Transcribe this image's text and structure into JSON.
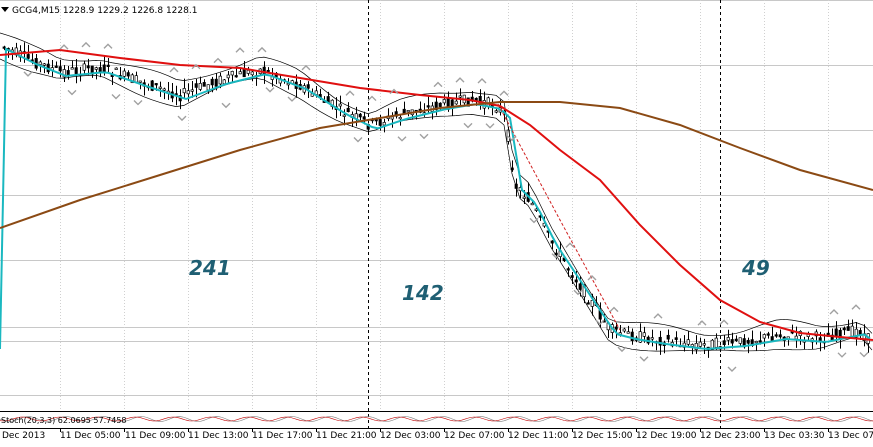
{
  "header": {
    "symbol_info": "GCG4,M15  1228.9 1229.2 1226.8 1228.1"
  },
  "annotations": {
    "left": "241",
    "middle": "142",
    "right": "49"
  },
  "oscillator": {
    "label": "Stoch(20,3,3) 62.0695 57.7458"
  },
  "time_axis": {
    "labels": [
      "Dec 2013",
      "11 Dec 05:00",
      "11 Dec 09:00",
      "11 Dec 13:00",
      "11 Dec 17:00",
      "11 Dec 21:00",
      "12 Dec 03:00",
      "12 Dec 07:00",
      "12 Dec 11:00",
      "12 Dec 15:00",
      "12 Dec 19:00",
      "12 Dec 23:00",
      "13 Dec 03:30",
      "13 Dec 07:"
    ]
  },
  "colors": {
    "background": "#ffffff",
    "grid": "#c8c8c8",
    "ma_red": "#e01010",
    "ma_brown": "#8b4a14",
    "ma_cyan": "#1ab8c0",
    "annotation_text": "#1f5f73",
    "candles": "#000000",
    "fractals": "#a0a0a0"
  },
  "icons": [
    "dropdown-arrow-icon",
    "fractal-arrow-icon"
  ]
}
